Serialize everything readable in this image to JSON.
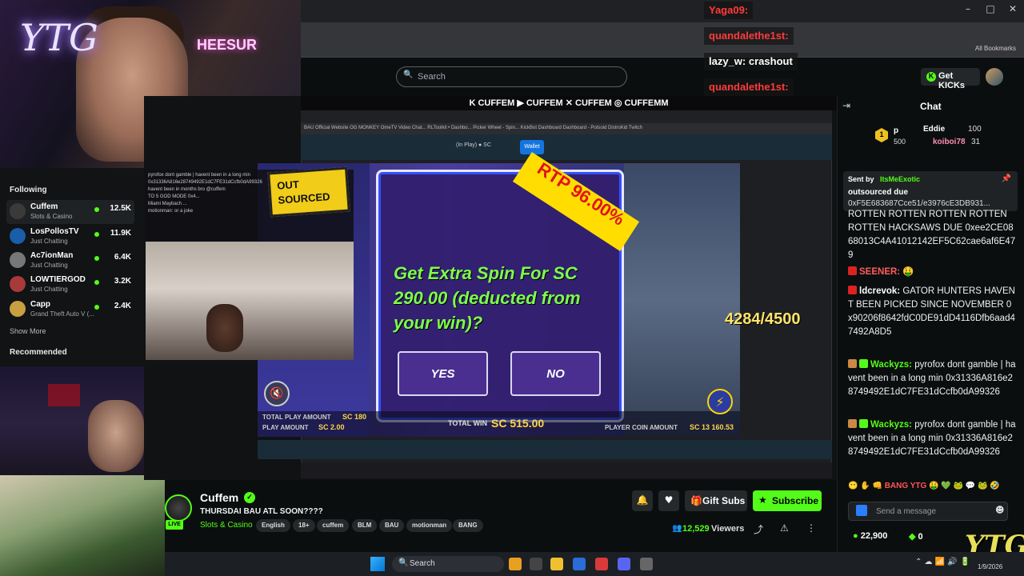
{
  "browser": {
    "bookmarks_label": "All Bookmarks",
    "win_controls": [
      "–",
      "□",
      "✕"
    ]
  },
  "header": {
    "search_placeholder": "Search",
    "get_kicks": "Get KICKs",
    "kick_icon": "K"
  },
  "banner": "K CUFFEM ▶ CUFFEM ✕ CUFFEM ◎ CUFFEMM",
  "sidebar": {
    "following_label": "Following",
    "items": [
      {
        "name": "Cuffem",
        "category": "Slots & Casino",
        "viewers": "12.5K",
        "color": "#3a3a3a"
      },
      {
        "name": "LosPollosTV",
        "category": "Just Chatting",
        "viewers": "11.9K",
        "color": "#1a5da8"
      },
      {
        "name": "Ac7ionMan",
        "category": "Just Chatting",
        "viewers": "6.4K",
        "color": "#777"
      },
      {
        "name": "LOWTIERGOD",
        "category": "Just Chatting",
        "viewers": "3.2K",
        "color": "#a83a3a"
      },
      {
        "name": "Capp",
        "category": "Grand Theft Auto V (...",
        "viewers": "2.4K",
        "color": "#c8a040"
      }
    ],
    "show_more": "Show More",
    "recommended_label": "Recommended"
  },
  "webcam": {
    "ytg_neon": "YTG",
    "neon_sign": "HEESUR"
  },
  "inner_browser": {
    "bookmarks": "BAU Official Website   OG MONKEY   OmeTV Video Chat...   RLToolkit • Dashbo...   Picker Wheel - Spin...   KickBot Dashboard   Dashboard - Potsoid   DistroKid   Twitch",
    "in_play": "(In Play)  ● SC",
    "wallet": "Wallet"
  },
  "overlay_chat": [
    "pyrofox dont gamble | havent been in a long min",
    "0x31336A816e28749492E1dC7FE31dCcfb0dA99326",
    "havent been in months bro @cuffem",
    "TO 5 GOD MODE 0x4...",
    "Miami Maybach ...",
    "motionman: or a joke"
  ],
  "game": {
    "out_logo_1": "OUT",
    "out_logo_2": "SOURCED",
    "rtp": "RTP 96.00%",
    "prompt": "Get Extra Spin For SC 290.00 (deducted from your win)?",
    "yes": "YES",
    "no": "NO",
    "counter": "4284/4500",
    "total_play_label": "TOTAL PLAY AMOUNT",
    "total_play_value": "SC 180",
    "play_amount_label": "PLAY AMOUNT",
    "play_amount_value": "SC 2.00",
    "total_win_label": "TOTAL WIN",
    "total_win_value": "SC 515.00",
    "player_coin_label": "PLAYER COIN AMOUNT",
    "player_coin_value": "SC 13 160.53",
    "mute_icon": "🔇",
    "bolt_icon": "⚡"
  },
  "channel": {
    "name": "Cuffem",
    "live": "LIVE",
    "title": "THURSDAI BAU ATL SOON????",
    "category": "Slots & Casino",
    "tags": [
      "English",
      "18+",
      "cuffem",
      "BLM",
      "BAU",
      "motionman",
      "BANG"
    ],
    "viewers": "12,529",
    "viewers_label": "Viewers",
    "gift_subs": "Gift Subs",
    "subscribe": "Subscribe",
    "bell_icon": "🔔",
    "heart_icon": "♥",
    "gift_icon": "🎁",
    "star_icon": "★",
    "share_icon": "⤴",
    "warn_icon": "⚠",
    "more_icon": "⋮"
  },
  "overlays": [
    {
      "user": "Yaga09:",
      "msg": "",
      "color": "#ff3b3b"
    },
    {
      "user": "quandalethe1st:",
      "msg": "",
      "color": "#ff3b3b"
    },
    {
      "user": "lazy_w:",
      "msg": "crashout",
      "color": "#ffffff"
    },
    {
      "user": "quandalethe1st:",
      "msg": "",
      "color": "#ff3b3b"
    }
  ],
  "chat": {
    "title": "Chat",
    "leaders": [
      {
        "name": "p",
        "value": "500"
      },
      {
        "name": "Eddie",
        "value": "100"
      },
      {
        "name": "koiboi78",
        "value": "31"
      }
    ],
    "pinned_by_label": "Sent by",
    "pinned_by_user": "ItsMeExotic",
    "pinned_text": "outsourced due",
    "pinned_addr": "0xF5E683687Cce51/e3976cE3DB931...",
    "messages": [
      {
        "user": "",
        "text": "ROTTEN ROTTEN ROTTEN ROTTEN ROTTEN HACKSAWS DUE 0xee2CE0868013C4A41012142EF5C62cae6af6E479",
        "color": "#ffffff"
      },
      {
        "user": "SEENER:",
        "text": "🤑",
        "color": "#ff5c5c"
      },
      {
        "user": "ldcrevok:",
        "text": "GATOR HUNTERS HAVENT BEEN PICKED SINCE NOVEMBER 0x90206f8642fdC0DE91dD4116Dfb6aad47492A8D5",
        "color": "#ffffff"
      },
      {
        "user": "Wackyzs:",
        "text": "pyrofox dont gamble | havent been in a long min 0x31336A816e28749492E1dC7FE31dCcfb0dA99326",
        "color": "#53fc18"
      },
      {
        "user": "Wackyzs:",
        "text": "pyrofox dont gamble | havent been in a long min 0x31336A816e28749492E1dC7FE31dCcfb0dA99326",
        "color": "#53fc18"
      }
    ],
    "emotes": "😶 ✋ 👊 BANG YTG 🤑 💚 🐸 💬 🐸 🤣",
    "input_placeholder": "Send a message",
    "points": "22,900",
    "kicks": "0"
  },
  "corner_logo": "YTG",
  "taskbar": {
    "search": "Search",
    "tray": "⌃  ☁  📶  🔊  🔋",
    "date": "1/9/2026"
  }
}
